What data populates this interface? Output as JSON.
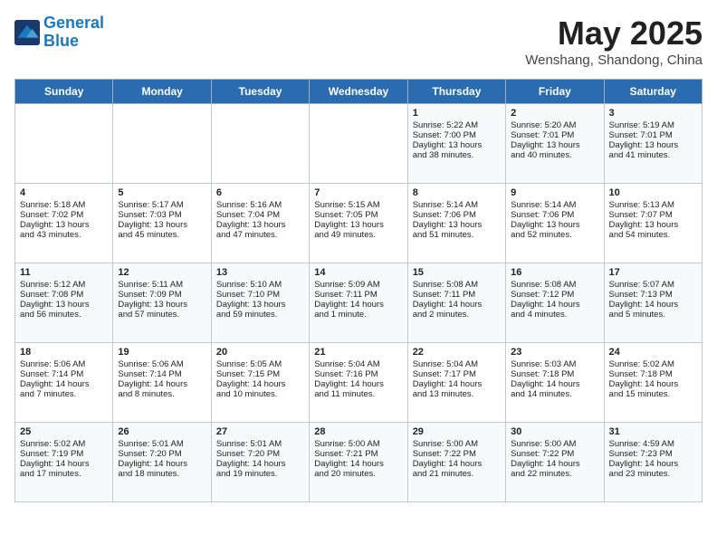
{
  "header": {
    "logo_line1": "General",
    "logo_line2": "Blue",
    "month": "May 2025",
    "location": "Wenshang, Shandong, China"
  },
  "weekdays": [
    "Sunday",
    "Monday",
    "Tuesday",
    "Wednesday",
    "Thursday",
    "Friday",
    "Saturday"
  ],
  "weeks": [
    [
      {
        "day": "",
        "info": ""
      },
      {
        "day": "",
        "info": ""
      },
      {
        "day": "",
        "info": ""
      },
      {
        "day": "",
        "info": ""
      },
      {
        "day": "1",
        "info": "Sunrise: 5:22 AM\nSunset: 7:00 PM\nDaylight: 13 hours\nand 38 minutes."
      },
      {
        "day": "2",
        "info": "Sunrise: 5:20 AM\nSunset: 7:01 PM\nDaylight: 13 hours\nand 40 minutes."
      },
      {
        "day": "3",
        "info": "Sunrise: 5:19 AM\nSunset: 7:01 PM\nDaylight: 13 hours\nand 41 minutes."
      }
    ],
    [
      {
        "day": "4",
        "info": "Sunrise: 5:18 AM\nSunset: 7:02 PM\nDaylight: 13 hours\nand 43 minutes."
      },
      {
        "day": "5",
        "info": "Sunrise: 5:17 AM\nSunset: 7:03 PM\nDaylight: 13 hours\nand 45 minutes."
      },
      {
        "day": "6",
        "info": "Sunrise: 5:16 AM\nSunset: 7:04 PM\nDaylight: 13 hours\nand 47 minutes."
      },
      {
        "day": "7",
        "info": "Sunrise: 5:15 AM\nSunset: 7:05 PM\nDaylight: 13 hours\nand 49 minutes."
      },
      {
        "day": "8",
        "info": "Sunrise: 5:14 AM\nSunset: 7:06 PM\nDaylight: 13 hours\nand 51 minutes."
      },
      {
        "day": "9",
        "info": "Sunrise: 5:14 AM\nSunset: 7:06 PM\nDaylight: 13 hours\nand 52 minutes."
      },
      {
        "day": "10",
        "info": "Sunrise: 5:13 AM\nSunset: 7:07 PM\nDaylight: 13 hours\nand 54 minutes."
      }
    ],
    [
      {
        "day": "11",
        "info": "Sunrise: 5:12 AM\nSunset: 7:08 PM\nDaylight: 13 hours\nand 56 minutes."
      },
      {
        "day": "12",
        "info": "Sunrise: 5:11 AM\nSunset: 7:09 PM\nDaylight: 13 hours\nand 57 minutes."
      },
      {
        "day": "13",
        "info": "Sunrise: 5:10 AM\nSunset: 7:10 PM\nDaylight: 13 hours\nand 59 minutes."
      },
      {
        "day": "14",
        "info": "Sunrise: 5:09 AM\nSunset: 7:11 PM\nDaylight: 14 hours\nand 1 minute."
      },
      {
        "day": "15",
        "info": "Sunrise: 5:08 AM\nSunset: 7:11 PM\nDaylight: 14 hours\nand 2 minutes."
      },
      {
        "day": "16",
        "info": "Sunrise: 5:08 AM\nSunset: 7:12 PM\nDaylight: 14 hours\nand 4 minutes."
      },
      {
        "day": "17",
        "info": "Sunrise: 5:07 AM\nSunset: 7:13 PM\nDaylight: 14 hours\nand 5 minutes."
      }
    ],
    [
      {
        "day": "18",
        "info": "Sunrise: 5:06 AM\nSunset: 7:14 PM\nDaylight: 14 hours\nand 7 minutes."
      },
      {
        "day": "19",
        "info": "Sunrise: 5:06 AM\nSunset: 7:14 PM\nDaylight: 14 hours\nand 8 minutes."
      },
      {
        "day": "20",
        "info": "Sunrise: 5:05 AM\nSunset: 7:15 PM\nDaylight: 14 hours\nand 10 minutes."
      },
      {
        "day": "21",
        "info": "Sunrise: 5:04 AM\nSunset: 7:16 PM\nDaylight: 14 hours\nand 11 minutes."
      },
      {
        "day": "22",
        "info": "Sunrise: 5:04 AM\nSunset: 7:17 PM\nDaylight: 14 hours\nand 13 minutes."
      },
      {
        "day": "23",
        "info": "Sunrise: 5:03 AM\nSunset: 7:18 PM\nDaylight: 14 hours\nand 14 minutes."
      },
      {
        "day": "24",
        "info": "Sunrise: 5:02 AM\nSunset: 7:18 PM\nDaylight: 14 hours\nand 15 minutes."
      }
    ],
    [
      {
        "day": "25",
        "info": "Sunrise: 5:02 AM\nSunset: 7:19 PM\nDaylight: 14 hours\nand 17 minutes."
      },
      {
        "day": "26",
        "info": "Sunrise: 5:01 AM\nSunset: 7:20 PM\nDaylight: 14 hours\nand 18 minutes."
      },
      {
        "day": "27",
        "info": "Sunrise: 5:01 AM\nSunset: 7:20 PM\nDaylight: 14 hours\nand 19 minutes."
      },
      {
        "day": "28",
        "info": "Sunrise: 5:00 AM\nSunset: 7:21 PM\nDaylight: 14 hours\nand 20 minutes."
      },
      {
        "day": "29",
        "info": "Sunrise: 5:00 AM\nSunset: 7:22 PM\nDaylight: 14 hours\nand 21 minutes."
      },
      {
        "day": "30",
        "info": "Sunrise: 5:00 AM\nSunset: 7:22 PM\nDaylight: 14 hours\nand 22 minutes."
      },
      {
        "day": "31",
        "info": "Sunrise: 4:59 AM\nSunset: 7:23 PM\nDaylight: 14 hours\nand 23 minutes."
      }
    ]
  ]
}
